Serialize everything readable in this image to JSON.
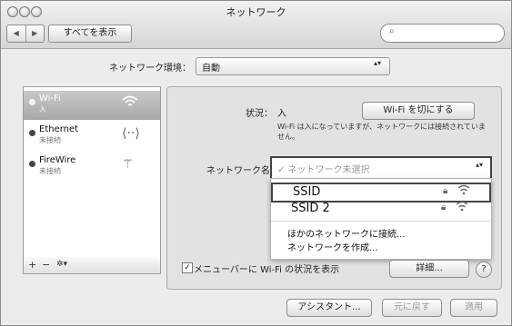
{
  "window": {
    "title": "ネットワーク"
  },
  "toolbar": {
    "back_label": "◀",
    "forward_label": "▶",
    "show_all_label": "すべてを表示",
    "search_placeholder": ""
  },
  "location": {
    "label": "ネットワーク環境：",
    "value": "自動"
  },
  "services": [
    {
      "name": "Wi-Fi",
      "status": "入",
      "selected": true,
      "icon": "wifi-icon"
    },
    {
      "name": "Ethernet",
      "status": "未接続",
      "selected": false,
      "icon": "ethernet-icon"
    },
    {
      "name": "FireWire",
      "status": "未接続",
      "selected": false,
      "icon": "firewire-icon"
    }
  ],
  "sidebar_footer": {
    "add": "+",
    "remove": "−",
    "action": "✲▾"
  },
  "detail": {
    "status_label": "状況：",
    "status_value": "入",
    "wifi_toggle_label": "Wi-Fi を切にする",
    "description": "Wi-Fi は入になっていますが、ネットワークには接続されていません。",
    "network_name_label": "ネットワーク名",
    "network_name_value": "✓ ネットワーク未選択",
    "networks": [
      {
        "ssid": "SSID",
        "locked": true
      },
      {
        "ssid": "SSID 2",
        "locked": true
      }
    ],
    "join_other": "ほかのネットワークに接続...",
    "create_network": "ネットワークを作成...",
    "show_in_menubar_label": "メニューバーに Wi-Fi の状況を表示",
    "show_in_menubar_checked": true,
    "advanced_label": "詳細...",
    "help_label": "?"
  },
  "bottom": {
    "assistant_label": "アシスタント...",
    "revert_label": "元に戻す",
    "apply_label": "適用"
  }
}
